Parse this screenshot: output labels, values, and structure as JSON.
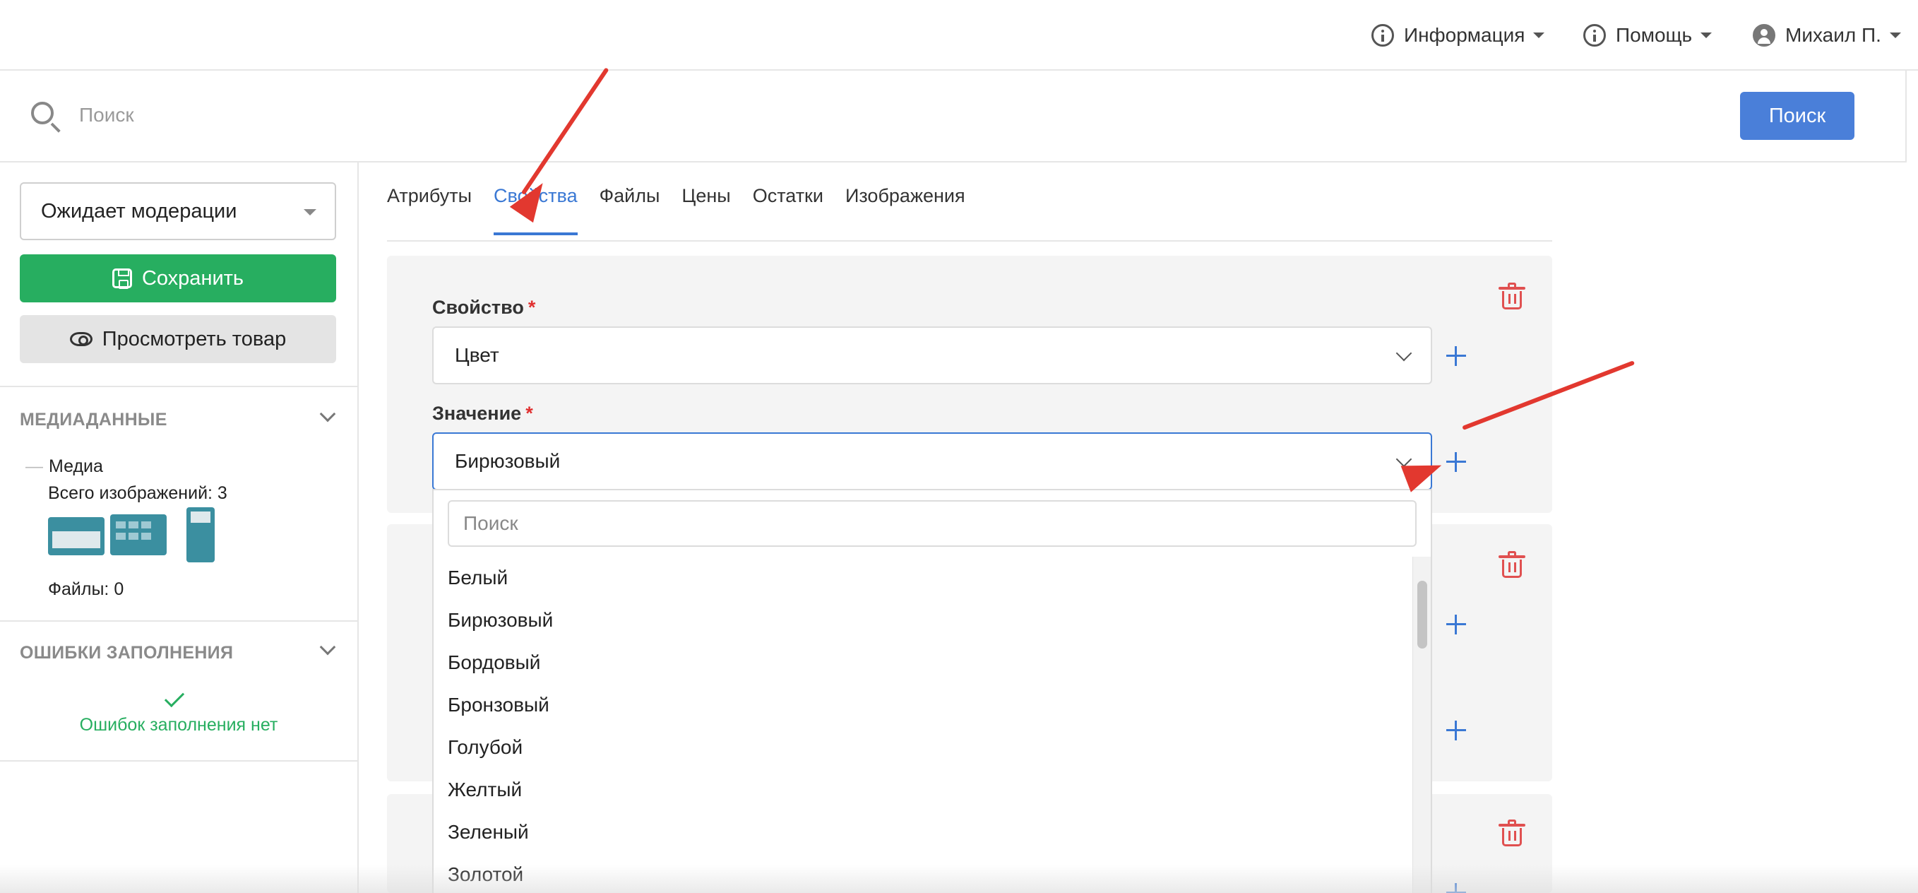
{
  "topbar": {
    "info_label": "Информация",
    "help_label": "Помощь",
    "user_label": "Михаил П."
  },
  "search": {
    "placeholder": "Поиск",
    "button_label": "Поиск"
  },
  "sidebar": {
    "status_value": "Ожидает модерации",
    "save_label": "Сохранить",
    "preview_label": "Просмотреть товар",
    "media_heading": "МЕДИАДАННЫЕ",
    "media_label": "Медиа",
    "media_count": "Всего изображений: 3",
    "files_count": "Файлы: 0",
    "errors_heading": "ОШИБКИ ЗАПОЛНЕНИЯ",
    "no_errors_text": "Ошибок заполнения нет"
  },
  "tabs": [
    {
      "label": "Атрибуты",
      "active": false
    },
    {
      "label": "Свойства",
      "active": true
    },
    {
      "label": "Файлы",
      "active": false
    },
    {
      "label": "Цены",
      "active": false
    },
    {
      "label": "Остатки",
      "active": false
    },
    {
      "label": "Изображения",
      "active": false
    }
  ],
  "property_card": {
    "property_label": "Свойство",
    "property_value": "Цвет",
    "value_label": "Значение",
    "value_value": "Бирюзовый",
    "required_mark": "*"
  },
  "dropdown": {
    "search_placeholder": "Поиск",
    "options": [
      "Белый",
      "Бирюзовый",
      "Бордовый",
      "Бронзовый",
      "Голубой",
      "Желтый",
      "Зеленый",
      "Золотой"
    ]
  },
  "colors": {
    "accent": "#3a78d4",
    "save_green": "#27ae60",
    "danger": "#e05050",
    "arrow_red": "#e2382f"
  }
}
